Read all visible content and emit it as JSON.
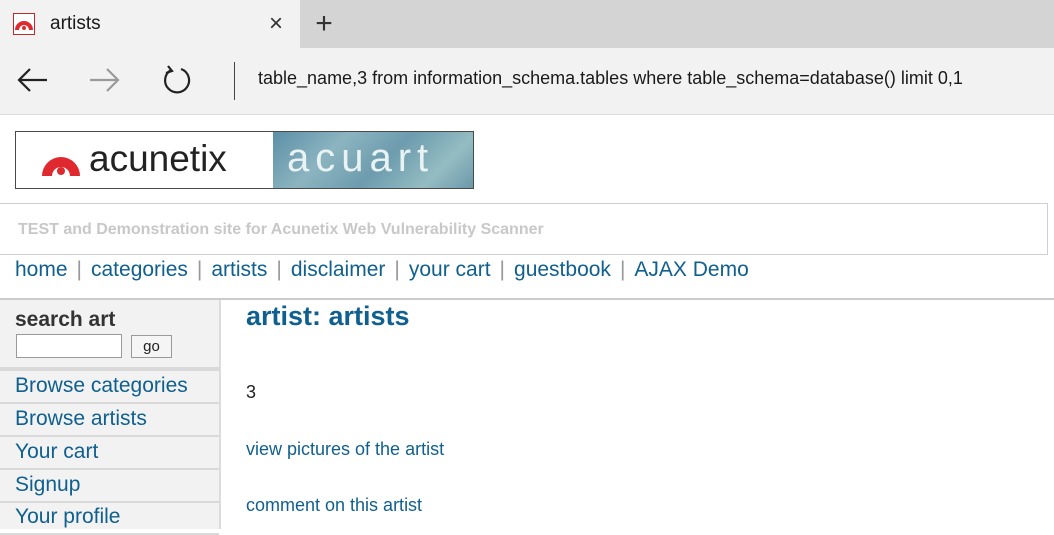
{
  "browser": {
    "tab_title": "artists",
    "close_glyph": "×",
    "new_tab_glyph": "+",
    "address": "table_name,3 from information_schema.tables where table_schema=database() limit 0,1"
  },
  "site": {
    "logo_left": "acunetix",
    "logo_right": "acuart",
    "tagline": "TEST and Demonstration site for Acunetix Web Vulnerability Scanner",
    "nav": [
      "home",
      "categories",
      "artists",
      "disclaimer",
      "your cart",
      "guestbook",
      "AJAX Demo"
    ],
    "nav_separator": "|"
  },
  "sidebar": {
    "search_title": "search art",
    "search_value": "",
    "go_label": "go",
    "items": [
      "Browse categories",
      "Browse artists",
      "Your cart",
      "Signup",
      "Your profile"
    ]
  },
  "content": {
    "title": "artist: artists",
    "value": "3",
    "link_pictures": "view pictures of the artist",
    "link_comment": "comment on this artist"
  },
  "colors": {
    "link": "#10608f",
    "brand_red": "#e0282f"
  }
}
